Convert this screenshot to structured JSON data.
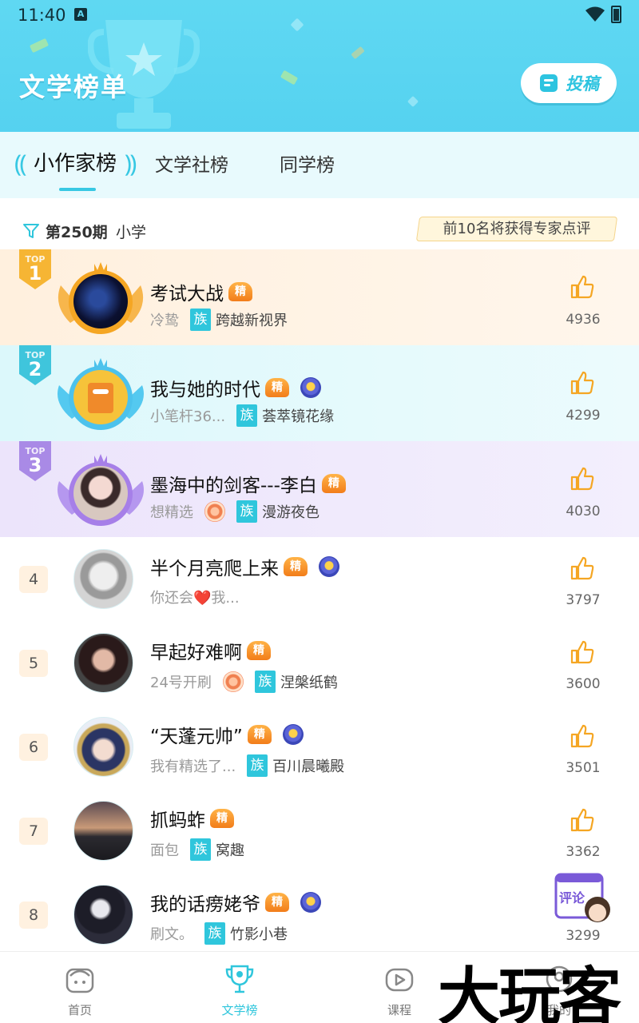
{
  "status_bar": {
    "time": "11:40",
    "sim_label": "A"
  },
  "header": {
    "title": "文学榜单",
    "submit_label": "投稿"
  },
  "tabs": [
    {
      "label": "小作家榜",
      "active": true
    },
    {
      "label": "文学社榜",
      "active": false
    },
    {
      "label": "同学榜",
      "active": false
    }
  ],
  "filter": {
    "period": "第250期",
    "grade": "小学",
    "reward_note": "前10名将获得专家点评"
  },
  "ranking": [
    {
      "rank": "1",
      "top_label": "TOP",
      "title": "考试大战",
      "author": "冷鸷",
      "clan_tag": "族",
      "clan": "跨越新视界",
      "likes": "4936",
      "medal": false,
      "hex_badge": false
    },
    {
      "rank": "2",
      "top_label": "TOP",
      "title": "我与她的时代",
      "author": "小笔杆36...",
      "clan_tag": "族",
      "clan": "荟萃镜花缘",
      "likes": "4299",
      "medal": true,
      "hex_badge": false
    },
    {
      "rank": "3",
      "top_label": "TOP",
      "title": "墨海中的剑客---李白",
      "author": "想精选",
      "clan_tag": "族",
      "clan": "漫游夜色",
      "likes": "4030",
      "medal": false,
      "hex_badge": true
    },
    {
      "rank": "4",
      "title": "半个月亮爬上来",
      "author": "你还会❤️我...",
      "clan_tag": "",
      "clan": "",
      "likes": "3797",
      "medal": true,
      "hex_badge": false
    },
    {
      "rank": "5",
      "title": "早起好难啊",
      "author": "24号开刷",
      "clan_tag": "族",
      "clan": "涅槃纸鹤",
      "likes": "3600",
      "medal": false,
      "hex_badge": true
    },
    {
      "rank": "6",
      "title": "“天蓬元帅”",
      "author": "我有精选了...",
      "clan_tag": "族",
      "clan": "百川晨曦殿",
      "likes": "3501",
      "medal": true,
      "hex_badge": false
    },
    {
      "rank": "7",
      "title": "抓蚂蚱",
      "author": "面包",
      "clan_tag": "族",
      "clan": "窝趣",
      "likes": "3362",
      "medal": false,
      "hex_badge": false
    },
    {
      "rank": "8",
      "title": "我的话痨姥爷",
      "author": "刷文。",
      "clan_tag": "族",
      "clan": "竹影小巷",
      "likes": "3299",
      "medal": true,
      "hex_badge": false
    }
  ],
  "jing_label": "精",
  "floating": {
    "label": "评论"
  },
  "bottom_nav": [
    {
      "label": "首页",
      "active": false
    },
    {
      "label": "文学榜",
      "active": true
    },
    {
      "label": "课程",
      "active": false
    },
    {
      "label": "我的",
      "active": false
    }
  ],
  "watermark": "大玩客",
  "colors": {
    "accent": "#2fc6dc",
    "header_bg": "#5fd8f2",
    "like": "#f5a623"
  }
}
